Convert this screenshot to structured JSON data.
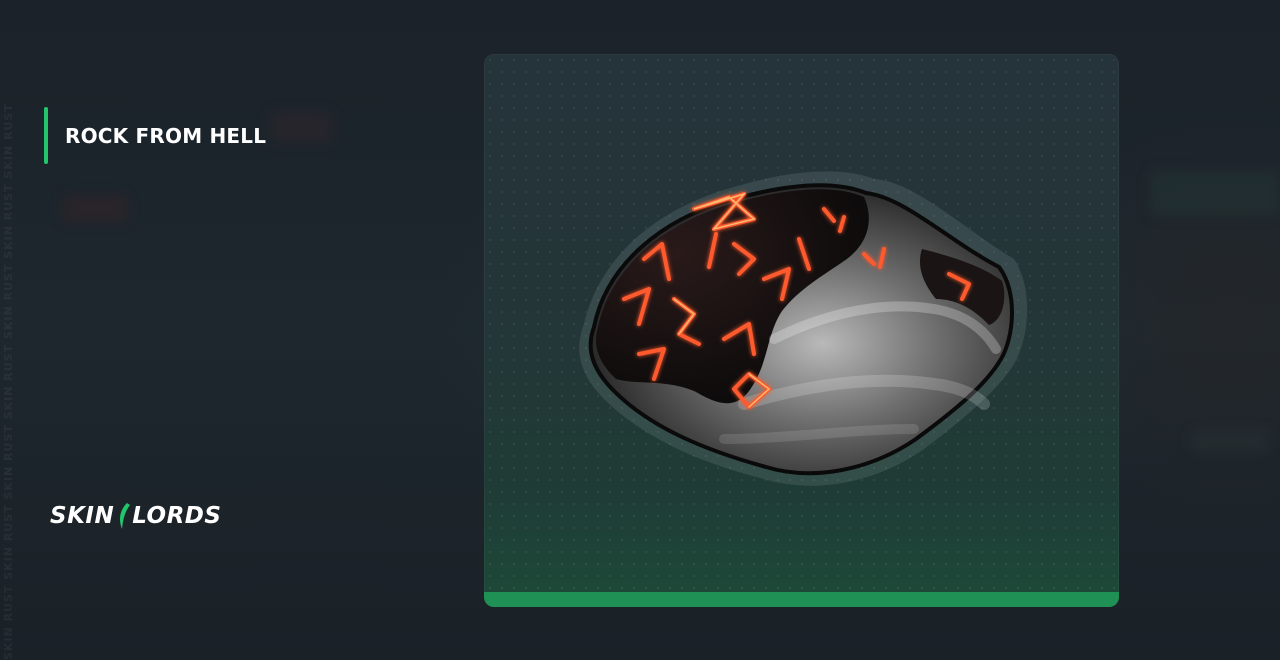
{
  "item": {
    "name": "ROCK FROM HELL"
  },
  "brand": {
    "logo_left": "SKIN",
    "logo_right": "LORDS",
    "watermark": "SKIN RUST SKIN RUST SKIN RUST SKIN RUST SKIN RUST SKIN RUST SKIN RUST"
  },
  "colors": {
    "accent": "#23c46b",
    "panel_bar": "#1f9155",
    "background": "#1c242b"
  },
  "icons": {
    "logo_mark": "green-slash-icon",
    "item_image": "rock-from-hell-skin"
  }
}
